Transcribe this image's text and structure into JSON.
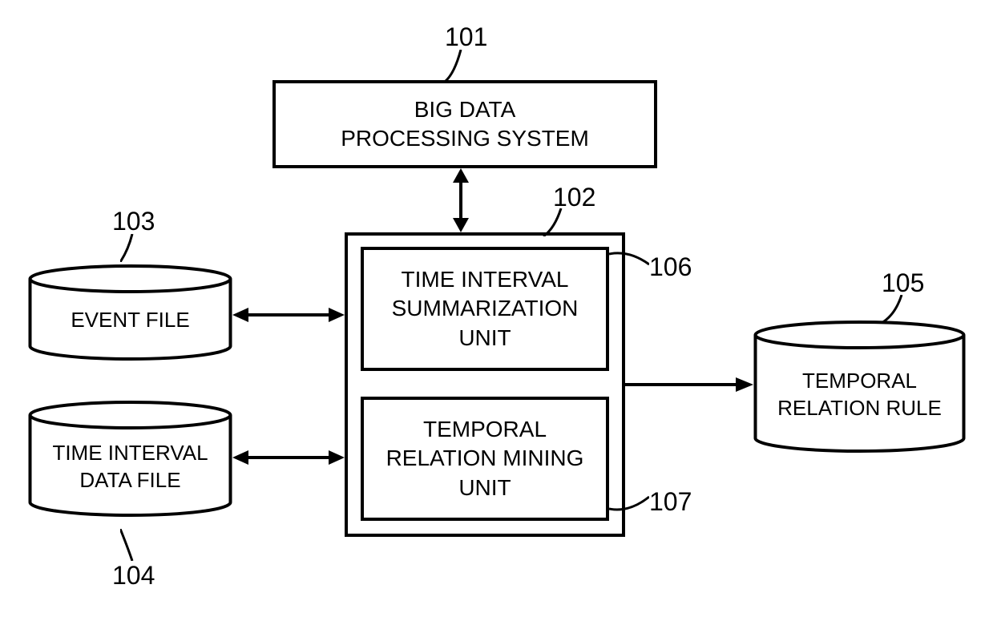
{
  "refs": {
    "r101": "101",
    "r102": "102",
    "r103": "103",
    "r104": "104",
    "r105": "105",
    "r106": "106",
    "r107": "107"
  },
  "blocks": {
    "bigdata": "BIG DATA\nPROCESSING SYSTEM",
    "summarization": "TIME INTERVAL\nSUMMARIZATION\nUNIT",
    "mining": "TEMPORAL\nRELATION MINING\nUNIT",
    "event_file": "EVENT FILE",
    "time_data": "TIME INTERVAL\nDATA FILE",
    "temporal_rule": "TEMPORAL\nRELATION RULE"
  }
}
